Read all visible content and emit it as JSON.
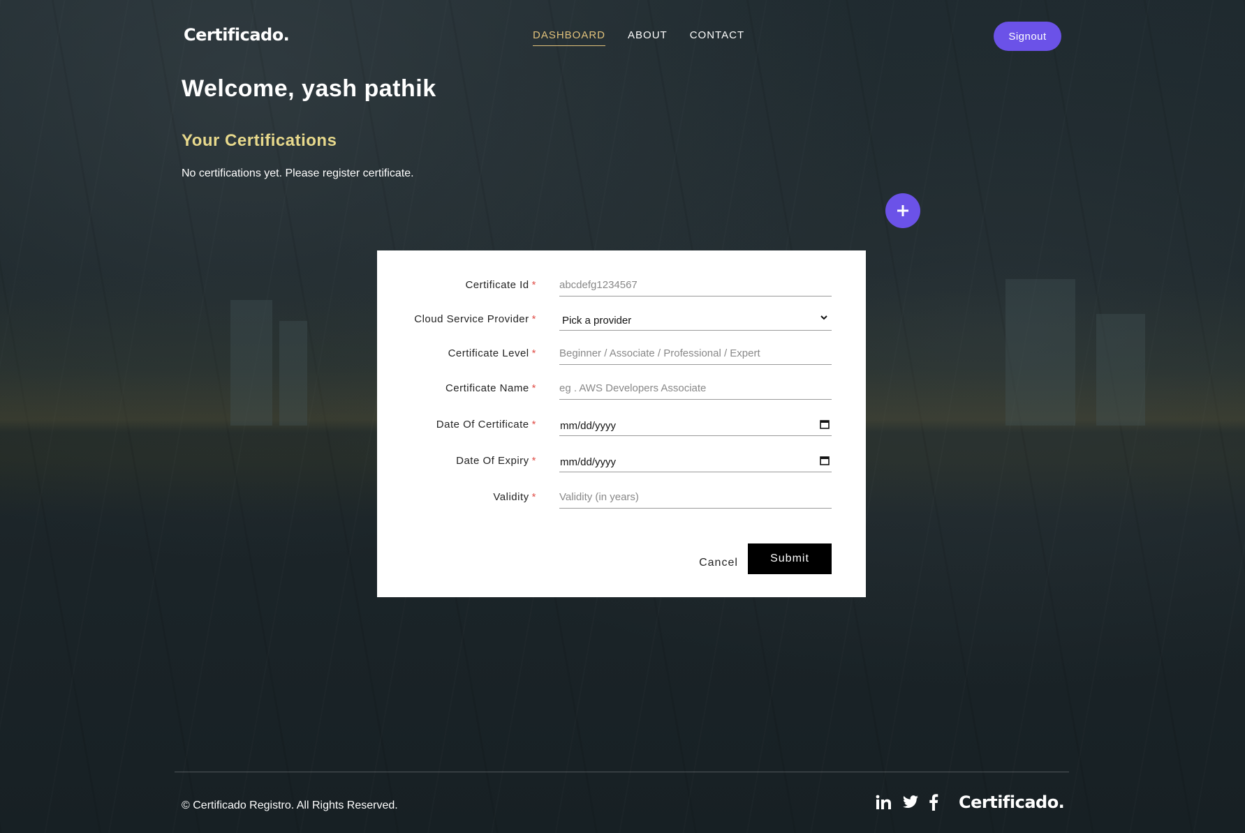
{
  "header": {
    "logo": "Certificado.",
    "nav": [
      {
        "label": "DASHBOARD",
        "active": true
      },
      {
        "label": "ABOUT",
        "active": false
      },
      {
        "label": "CONTACT",
        "active": false
      }
    ],
    "signout_label": "Signout"
  },
  "main": {
    "welcome": "Welcome, yash pathik",
    "section_title": "Your Certifications",
    "empty_message": "No certifications yet. Please register certificate.",
    "add_button_icon": "plus-icon"
  },
  "form": {
    "fields": [
      {
        "label": "Certificate Id",
        "required": "*",
        "placeholder": "abcdefg1234567"
      },
      {
        "label": "Cloud Service Provider",
        "required": "*",
        "value": "Pick a provider"
      },
      {
        "label": "Certificate Level",
        "required": "*",
        "placeholder": "Beginner / Associate / Professional / Expert"
      },
      {
        "label": "Certificate Name",
        "required": "*",
        "placeholder": "eg . AWS Developers Associate"
      },
      {
        "label": "Date Of Certificate",
        "required": "*",
        "value": "mm/dd/yyyy"
      },
      {
        "label": "Date Of Expiry",
        "required": "*",
        "value": "mm/dd/yyyy"
      },
      {
        "label": "Validity",
        "required": "*",
        "placeholder": "Validity (in years)"
      }
    ],
    "cancel_label": "Cancel",
    "submit_label": "Submit"
  },
  "footer": {
    "copyright": "© Certificado Registro. All Rights Reserved.",
    "social_icons": [
      "linkedin-icon",
      "twitter-icon",
      "facebook-icon"
    ],
    "logo": "Certificado."
  },
  "colors": {
    "accent": "#6b52e8",
    "nav_active": "#e2c27b",
    "section_title": "#e8d98c",
    "required": "#e0504a"
  }
}
